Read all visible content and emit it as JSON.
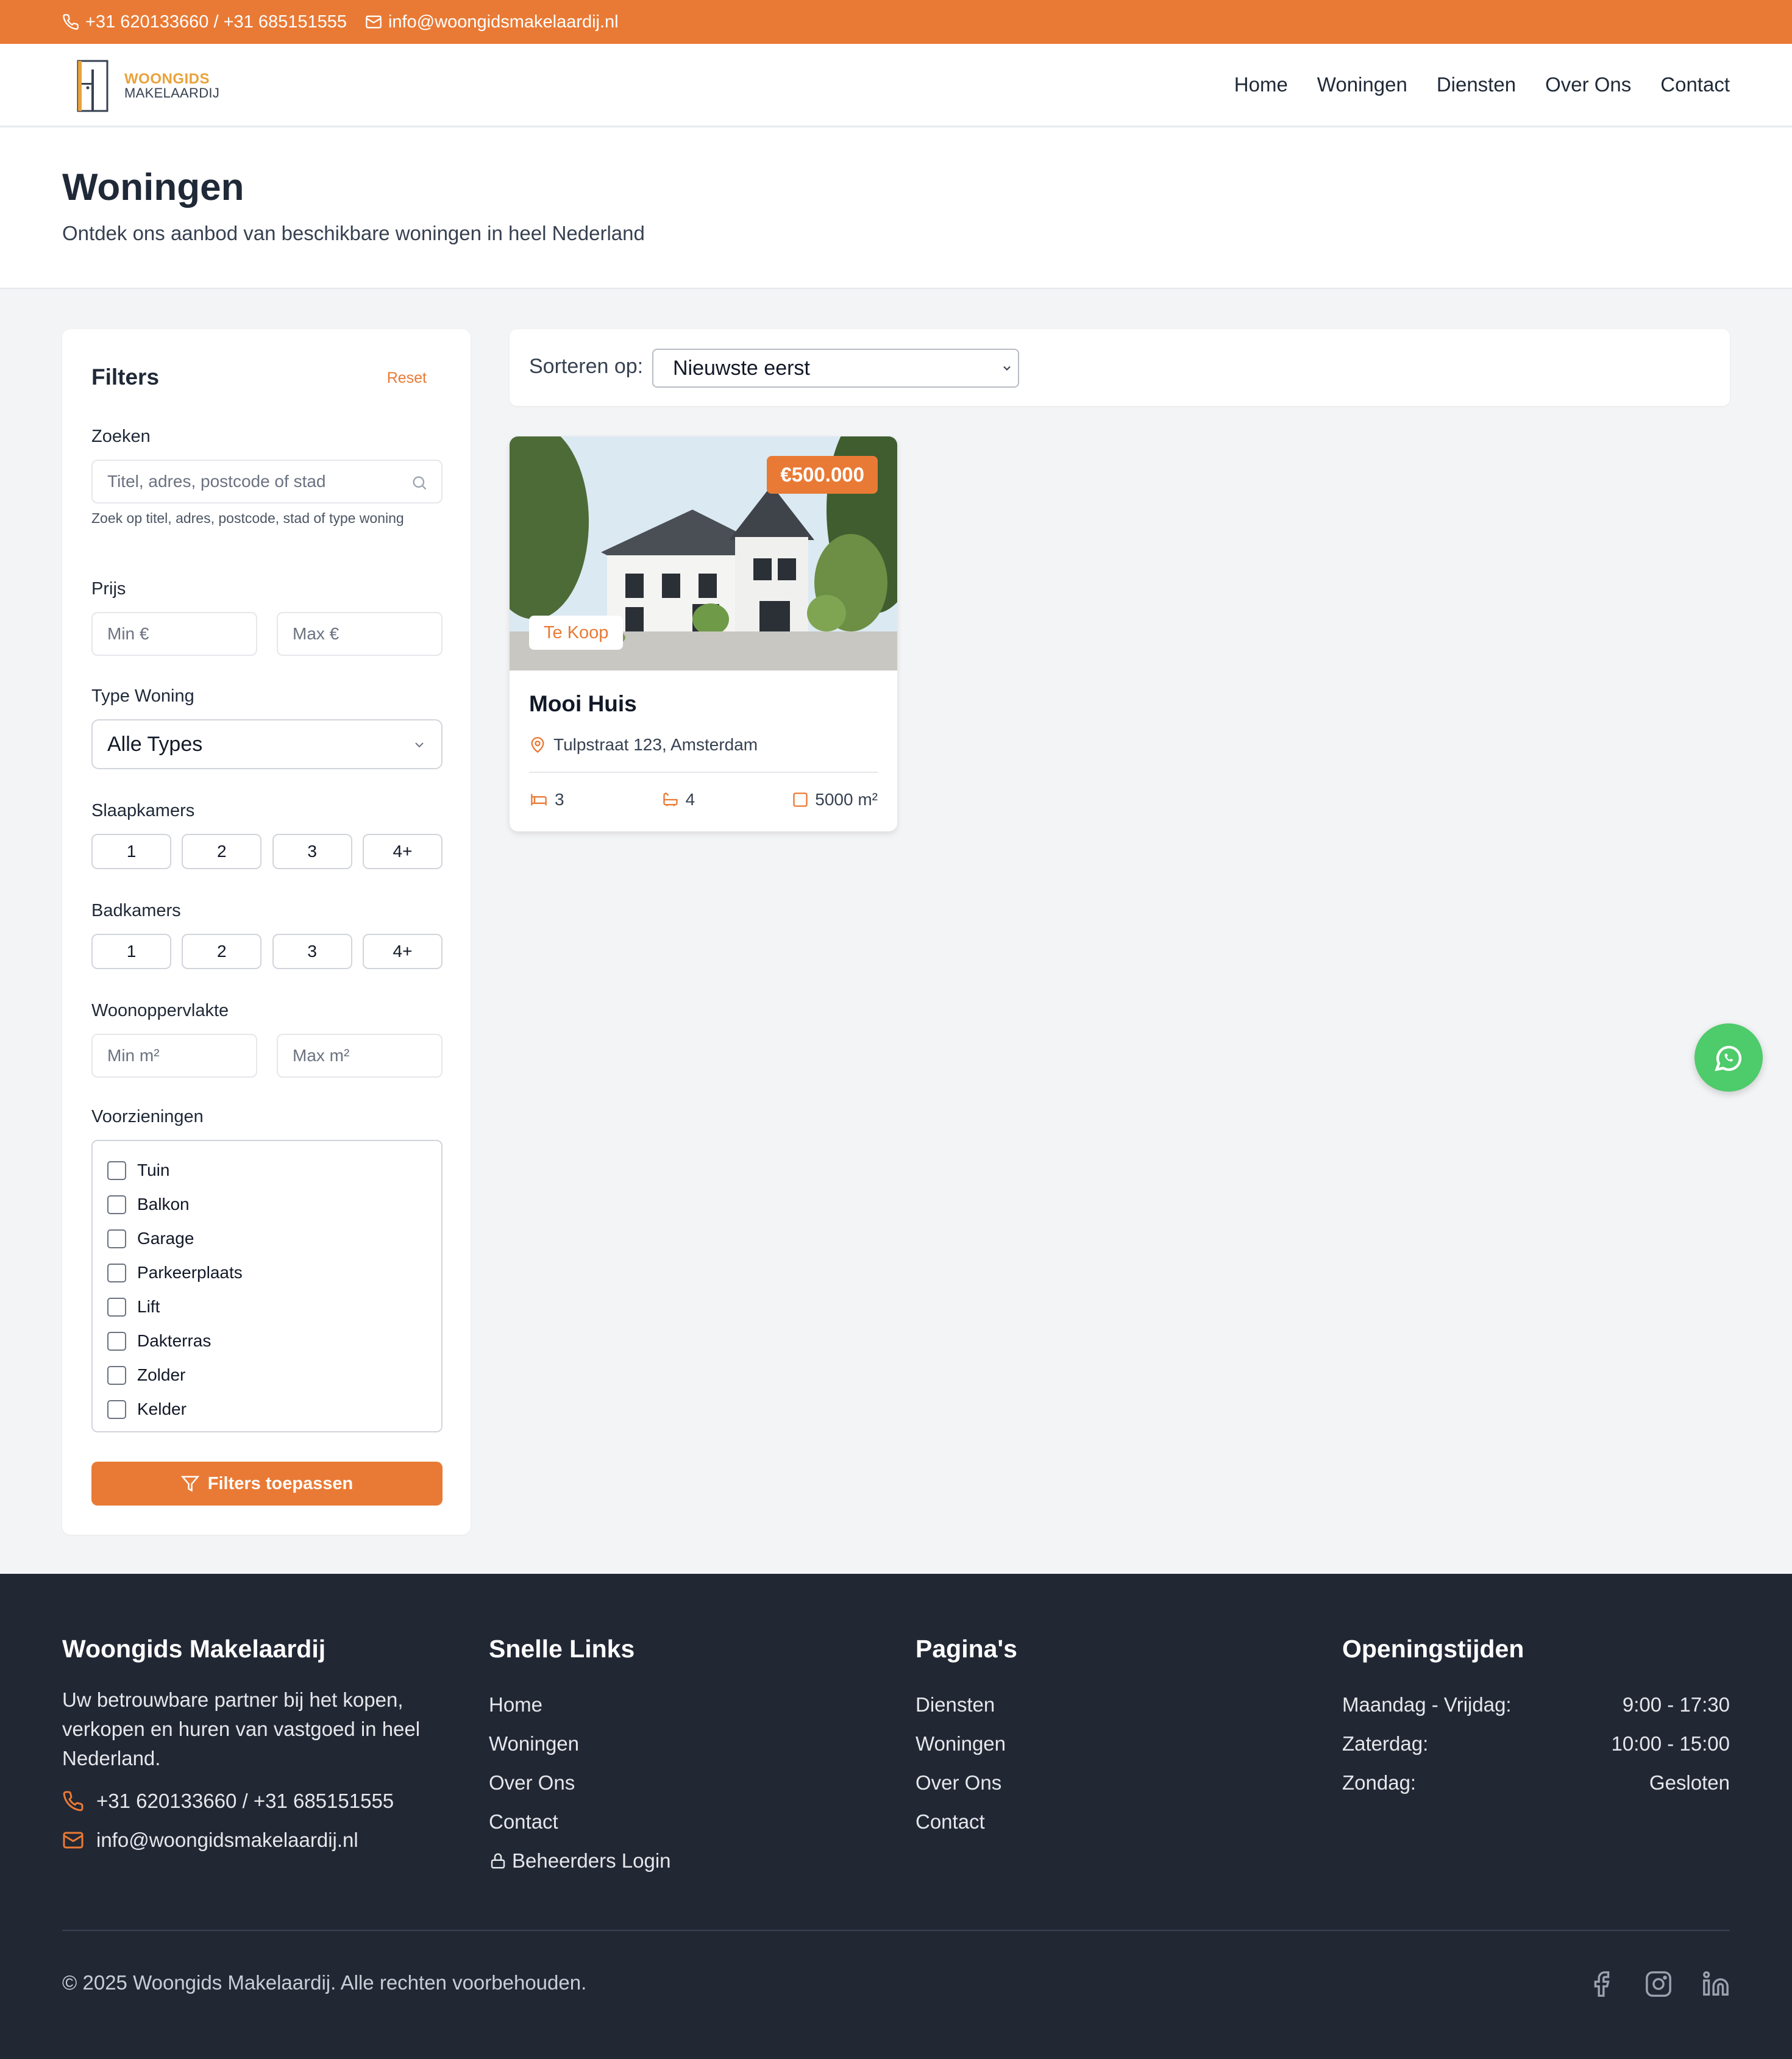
{
  "topbar": {
    "phone": "+31 620133660 / +31 685151555",
    "email": "info@woongidsmakelaardij.nl"
  },
  "brand": {
    "line1": "WOONGIDS",
    "line2": "MAKELAARDIJ"
  },
  "nav": [
    "Home",
    "Woningen",
    "Diensten",
    "Over Ons",
    "Contact"
  ],
  "page": {
    "title": "Woningen",
    "subtitle": "Ontdek ons aanbod van beschikbare woningen in heel Nederland"
  },
  "filters": {
    "title": "Filters",
    "reset": "Reset",
    "search": {
      "label": "Zoeken",
      "placeholder": "Titel, adres, postcode of stad",
      "hint": "Zoek op titel, adres, postcode, stad of type woning"
    },
    "price": {
      "label": "Prijs",
      "min": "Min €",
      "max": "Max €"
    },
    "type": {
      "label": "Type Woning",
      "value": "Alle Types"
    },
    "bedrooms": {
      "label": "Slaapkamers",
      "options": [
        "1",
        "2",
        "3",
        "4+"
      ]
    },
    "bathrooms": {
      "label": "Badkamers",
      "options": [
        "1",
        "2",
        "3",
        "4+"
      ]
    },
    "area": {
      "label": "Woonoppervlakte",
      "min": "Min m²",
      "max": "Max m²"
    },
    "amenities": {
      "label": "Voorzieningen",
      "items": [
        "Tuin",
        "Balkon",
        "Garage",
        "Parkeerplaats",
        "Lift",
        "Dakterras",
        "Zolder",
        "Kelder"
      ]
    },
    "apply": "Filters toepassen"
  },
  "sort": {
    "label": "Sorteren op:",
    "value": "Nieuwste eerst"
  },
  "listing": {
    "price": "€500.000",
    "status": "Te Koop",
    "title": "Mooi Huis",
    "address": "Tulpstraat 123, Amsterdam",
    "bedrooms": "3",
    "bathrooms": "4",
    "area": "5000 m²"
  },
  "footer": {
    "about": {
      "title": "Woongids Makelaardij",
      "desc": "Uw betrouwbare partner bij het kopen, verkopen en huren van vastgoed in heel Nederland.",
      "phone": "+31 620133660 / +31 685151555",
      "email": "info@woongidsmakelaardij.nl"
    },
    "quick": {
      "title": "Snelle Links",
      "links": [
        "Home",
        "Woningen",
        "Over Ons",
        "Contact"
      ],
      "login": "Beheerders Login"
    },
    "pages": {
      "title": "Pagina's",
      "links": [
        "Diensten",
        "Woningen",
        "Over Ons",
        "Contact"
      ]
    },
    "hours": {
      "title": "Openingstijden",
      "rows": [
        {
          "day": "Maandag - Vrijdag:",
          "time": "9:00 - 17:30"
        },
        {
          "day": "Zaterdag:",
          "time": "10:00 - 15:00"
        },
        {
          "day": "Zondag:",
          "time": "Gesloten"
        }
      ]
    },
    "copyright": "© 2025 Woongids Makelaardij. Alle rechten voorbehouden.",
    "social": [
      "facebook-icon",
      "instagram-icon",
      "linkedin-icon"
    ]
  },
  "colors": {
    "accent": "#e97a35",
    "footer": "#222734",
    "whatsapp": "#4ecb6a"
  }
}
